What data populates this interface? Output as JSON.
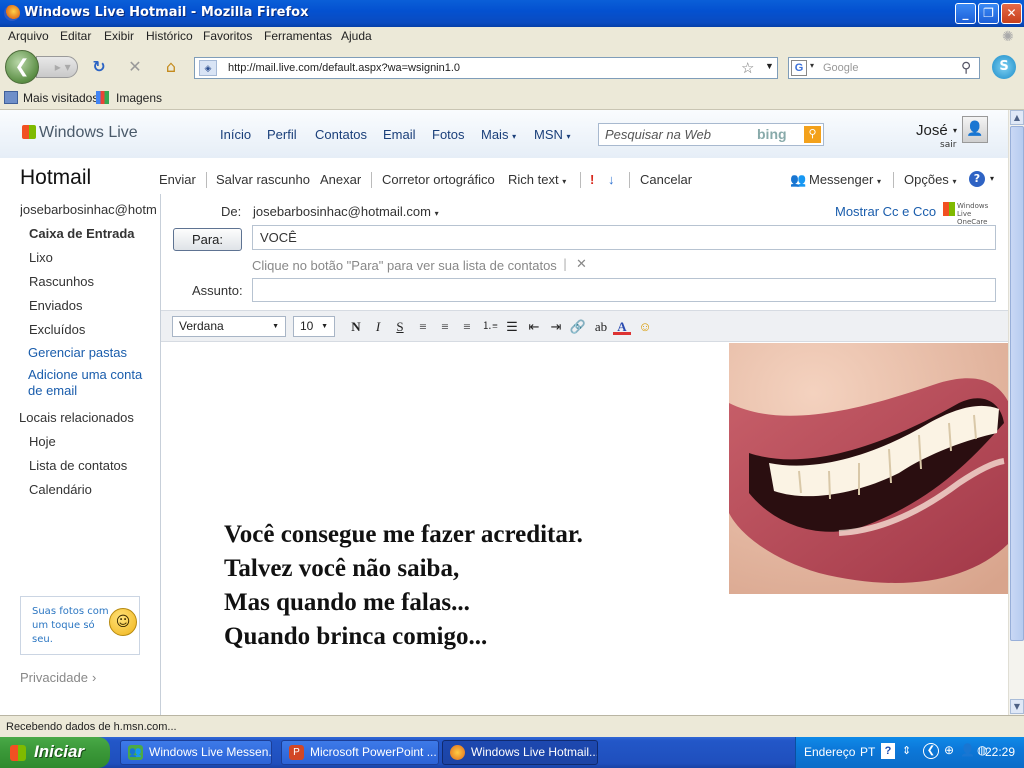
{
  "window": {
    "title": "Windows Live Hotmail - Mozilla Firefox"
  },
  "menu": [
    "Arquivo",
    "Editar",
    "Exibir",
    "Histórico",
    "Favoritos",
    "Ferramentas",
    "Ajuda"
  ],
  "address": {
    "url": "http://mail.live.com/default.aspx?wa=wsignin1.0"
  },
  "search": {
    "placeholder": "Google"
  },
  "bookmarks": [
    "Mais visitados",
    "Imagens"
  ],
  "wl": {
    "logo": "Windows Live",
    "nav": [
      "Início",
      "Perfil",
      "Contatos",
      "Email",
      "Fotos",
      "Mais",
      "MSN"
    ],
    "search_placeholder": "Pesquisar na Web",
    "bing": "bing",
    "user": "José",
    "signout": "sair"
  },
  "toolbar": {
    "title": "Hotmail",
    "send": "Enviar",
    "save_draft": "Salvar rascunho",
    "attach": "Anexar",
    "spell": "Corretor ortográfico",
    "rich": "Rich text",
    "cancel": "Cancelar",
    "messenger": "Messenger",
    "options": "Opções"
  },
  "sidebar": {
    "account": "josebarbosinhac@hotm",
    "folders": [
      "Caixa de Entrada",
      "Lixo",
      "Rascunhos",
      "Enviados",
      "Excluídos"
    ],
    "manage": "Gerenciar pastas",
    "add_account": "Adicione uma conta de email",
    "related_heading": "Locais relacionados",
    "related": [
      "Hoje",
      "Lista de contatos",
      "Calendário"
    ],
    "promo": "Suas fotos com um toque só seu.",
    "privacy": "Privacidade"
  },
  "compose": {
    "from_label": "De:",
    "from_value": "josebarbosinhac@hotmail.com",
    "show_cc": "Mostrar Cc e Cco",
    "onecare": "Windows Live OneCare",
    "to_button": "Para:",
    "to_value": "VOCÊ",
    "hint": "Clique no botão \"Para\" para ver sua lista de contatos",
    "subject_label": "Assunto:",
    "subject_value": "",
    "font": "Verdana",
    "size": "10",
    "fmt": {
      "bold": "N",
      "italic": "I",
      "underline": "S",
      "color": "A"
    },
    "body_lines": [
      "Você consegue me fazer acreditar.",
      "Talvez você não saiba,",
      "Mas quando me falas...",
      "Quando brinca comigo..."
    ]
  },
  "status": {
    "text": "Recebendo dados de h.msn.com..."
  },
  "taskbar": {
    "start": "Iniciar",
    "tasks": [
      "Windows Live Messen...",
      "Microsoft PowerPoint ...",
      "Windows Live Hotmail..."
    ],
    "address": "Endereço",
    "lang": "PT",
    "clock": "22:29"
  }
}
